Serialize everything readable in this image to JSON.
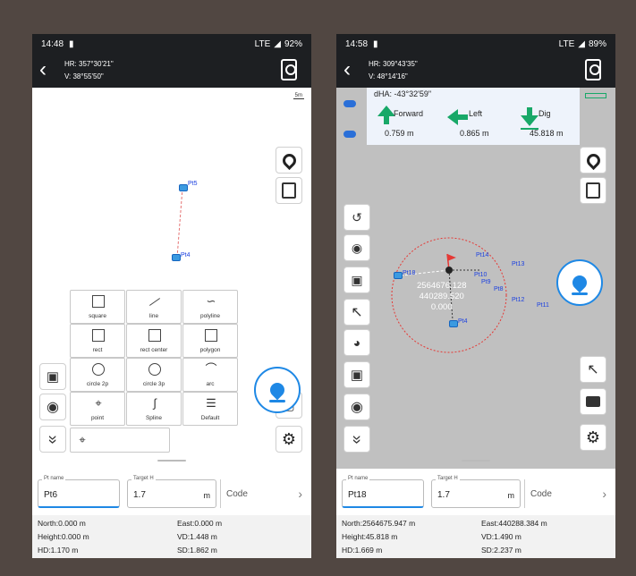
{
  "colors": {
    "accent": "#1e88e5",
    "status_bar": "#1d1f22",
    "guide_green": "#18a868",
    "point_label": "#1a3fe0",
    "stakeout_line": "#e53935"
  },
  "screen1": {
    "status": {
      "time": "14:48",
      "network": "LTE",
      "battery": "92%"
    },
    "header": {
      "hr": "HR: 357°30'21\"",
      "v": "V: 38°55'50\""
    },
    "map": {
      "scale_label": "5m",
      "points": [
        {
          "name": "Pt5"
        },
        {
          "name": "Pt4"
        }
      ]
    },
    "tools": [
      {
        "label": "square",
        "icon": "square-icon"
      },
      {
        "label": "line",
        "icon": "line-icon"
      },
      {
        "label": "polyline",
        "icon": "polyline-icon"
      },
      {
        "label": "rect",
        "icon": "rect-icon"
      },
      {
        "label": "rect center",
        "icon": "rect-center-icon"
      },
      {
        "label": "polygon",
        "icon": "polygon-icon"
      },
      {
        "label": "circle 2p",
        "icon": "circle-2p-icon"
      },
      {
        "label": "circle 3p",
        "icon": "circle-3p-icon"
      },
      {
        "label": "arc",
        "icon": "arc-icon"
      },
      {
        "label": "point",
        "icon": "point-icon"
      },
      {
        "label": "Spline",
        "icon": "spline-icon"
      },
      {
        "label": "Default",
        "icon": "layers-icon"
      }
    ],
    "form": {
      "pt_name_label": "Pt name",
      "pt_name_value": "Pt6",
      "target_h_label": "Target H",
      "target_h_value": "1.7",
      "target_h_unit": "m",
      "code_placeholder": "Code"
    },
    "info": {
      "north": "North:0.000 m",
      "east": "East:0.000 m",
      "height": "Height:0.000 m",
      "vd": "VD:1.448 m",
      "hd": "HD:1.170 m",
      "sd": "SD:1.862 m"
    }
  },
  "screen2": {
    "status": {
      "time": "14:58",
      "network": "LTE",
      "battery": "89%"
    },
    "header": {
      "hr": "HR: 309°43'35\"",
      "v": "V: 48°14'16\""
    },
    "guide": {
      "dha": "dHA: -43°32'59\"",
      "forward_label": "Forward",
      "forward_value": "0.759 m",
      "left_label": "Left",
      "left_value": "0.865 m",
      "dig_label": "Dig",
      "dig_value": "45.818 m"
    },
    "map": {
      "readout_n": "2564676.128",
      "readout_e": "440289.520",
      "readout_h": "0.000",
      "points": [
        {
          "name": "Pt14"
        },
        {
          "name": "Pt13"
        },
        {
          "name": "Pt10"
        },
        {
          "name": "Pt9"
        },
        {
          "name": "Pt8"
        },
        {
          "name": "Pt12"
        },
        {
          "name": "Pt11"
        },
        {
          "name": "Pt18"
        },
        {
          "name": "Pt4"
        }
      ]
    },
    "form": {
      "pt_name_label": "Pt name",
      "pt_name_value": "Pt18",
      "target_h_label": "Target H",
      "target_h_value": "1.7",
      "target_h_unit": "m",
      "code_placeholder": "Code"
    },
    "info": {
      "north": "North:2564675.947 m",
      "east": "East:440288.384 m",
      "height": "Height:45.818 m",
      "vd": "VD:1.490 m",
      "hd": "HD:1.669 m",
      "sd": "SD:2.237 m"
    }
  }
}
